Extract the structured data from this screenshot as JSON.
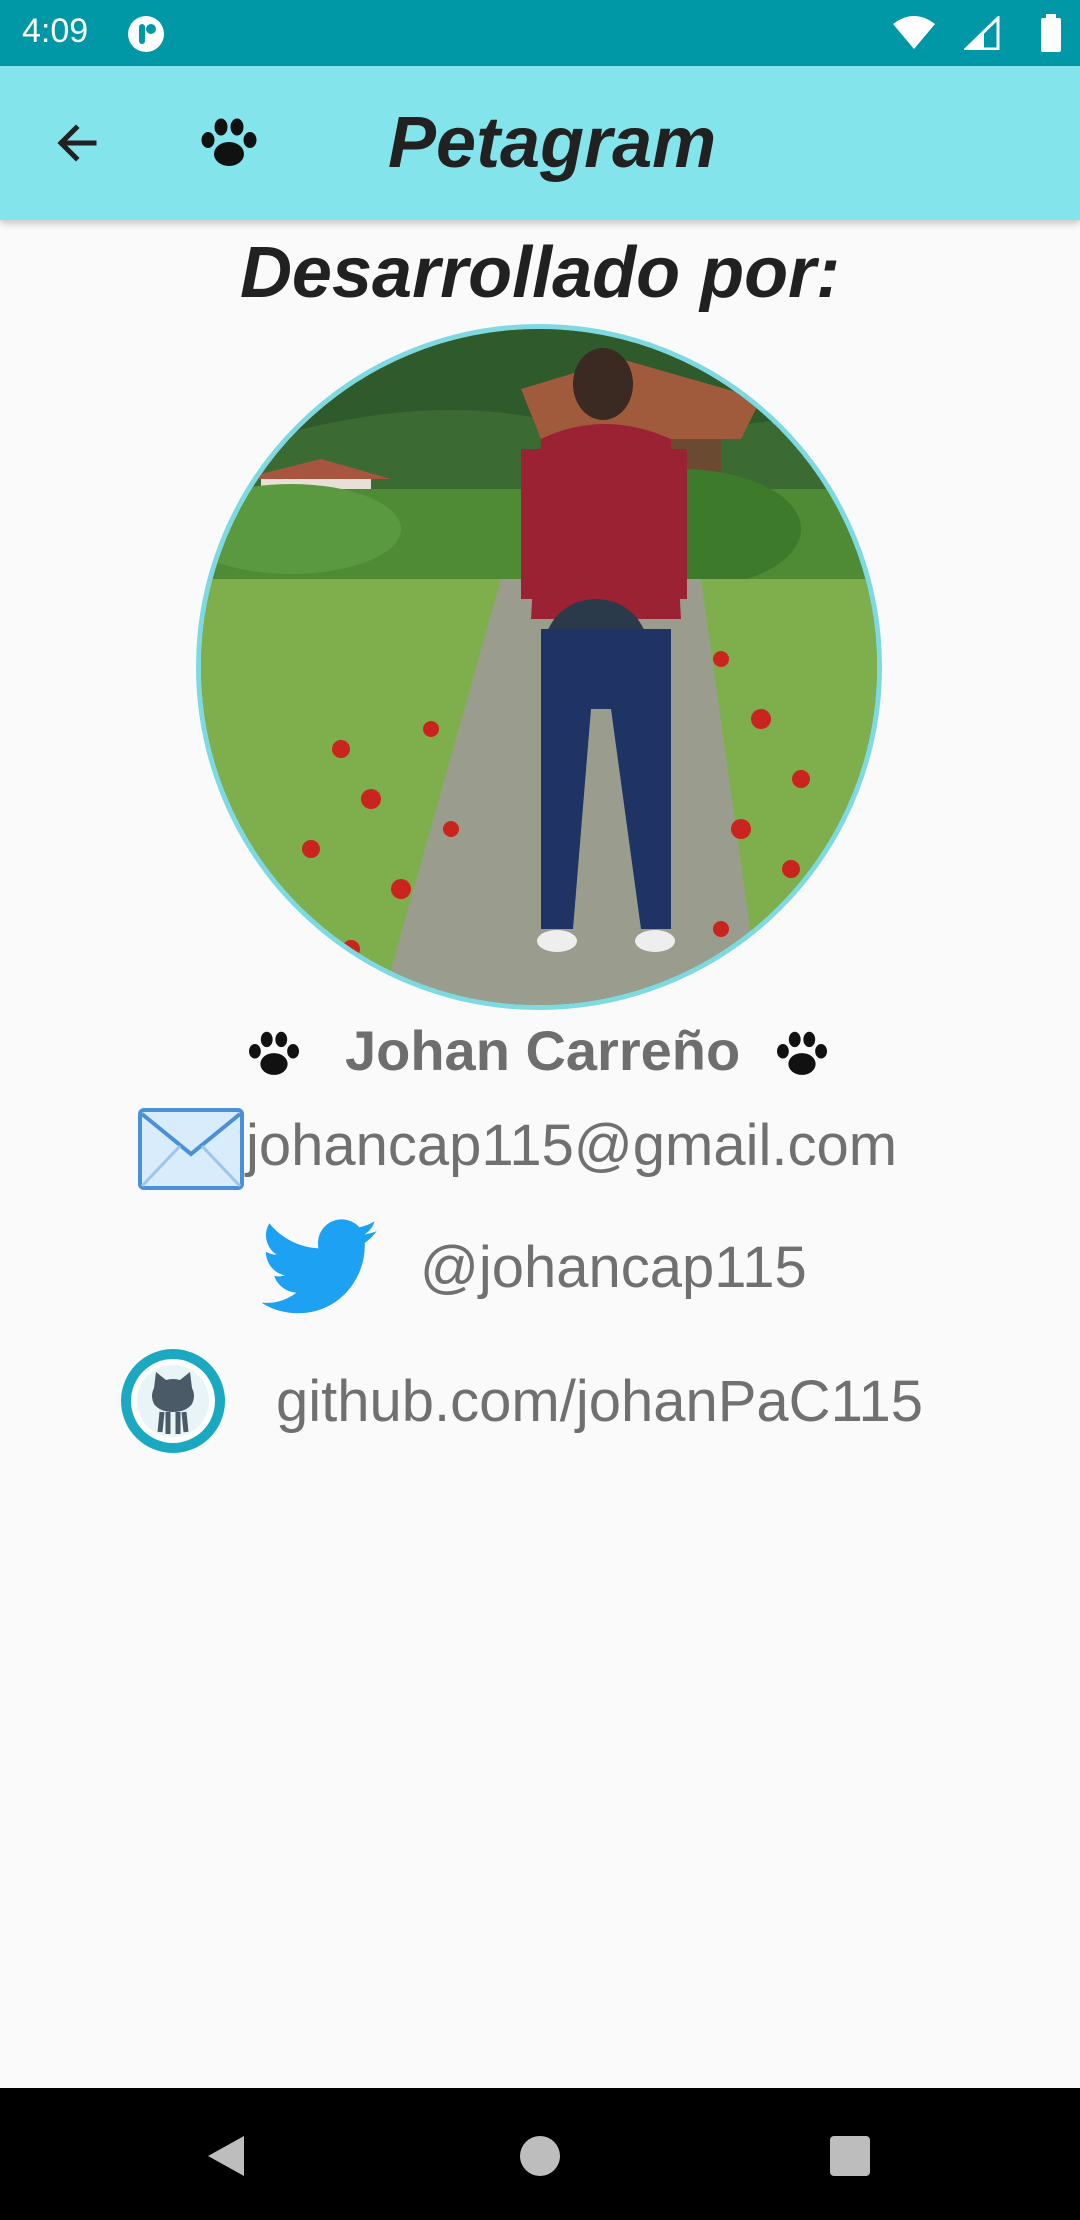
{
  "status_bar": {
    "time": "4:09"
  },
  "toolbar": {
    "title": "Petagram",
    "back_icon": "arrow-back-icon",
    "logo_icon": "paw-icon",
    "background_color": "#84e4ec"
  },
  "content": {
    "heading": "Desarrollado por:",
    "developer_name": "Johan Carreño",
    "email": "johancap115@gmail.com",
    "twitter": "@johancap115",
    "github": "github.com/johanPaC115"
  },
  "colors": {
    "status_bar": "#0097a7",
    "accent_border": "#7ed9e3",
    "twitter_blue": "#1da1f2",
    "github_ring": "#1aa9c0"
  }
}
